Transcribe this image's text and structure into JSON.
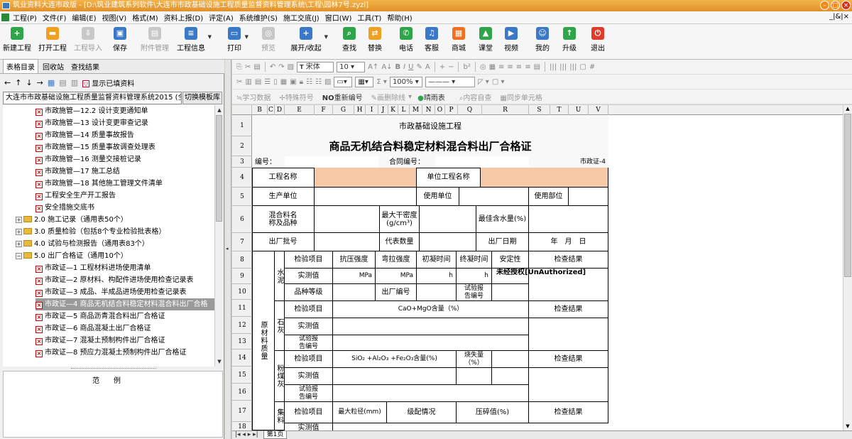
{
  "window": {
    "title": "筑业资料大连市政版 - [D:\\筑业建筑系列软件\\大连市市政基础设施工程质量监督资料管理系统\\工程\\园林7号.zyzl]"
  },
  "menu": {
    "items": [
      "工程(P)",
      "文件(F)",
      "编辑(E)",
      "视图(V)",
      "格式(M)",
      "资料上报(D)",
      "评定(A)",
      "系统维护(S)",
      "施工交底(J)",
      "窗口(W)",
      "工具(T)",
      "帮助(H)"
    ],
    "window_controls": "_|&|×"
  },
  "ribbon": {
    "new_project": "新建工程",
    "open_project": "打开工程",
    "import_project": "工程导入",
    "save": "保存",
    "attachments": "附件管理",
    "project_info": "工程信息",
    "print": "打印",
    "preview": "预览",
    "expand_collapse": "展开/收起",
    "find": "查找",
    "replace": "替换",
    "phone": "电话",
    "service": "客服",
    "mall": "商城",
    "classroom": "课堂",
    "video": "视频",
    "mine": "我的",
    "upgrade": "升级",
    "exit": "退出"
  },
  "left": {
    "tabs": [
      "表格目录",
      "回收站",
      "查找结果"
    ],
    "show_filled": "显示已填资料",
    "system_combo": "大连市市政基础设施工程质量监督资料管理系统2015 (全",
    "switch_template": "切换模板库",
    "tree": [
      "市政施管—12.2 设计变更通知单",
      "市政施管—13 设计变更审查记录",
      "市政施管—14 质量事故报告",
      "市政施管—15 质量事故调查处理表",
      "市政施管—16 测量交接桩记录",
      "市政施管—17 施工总结",
      "市政施管—18 其他施工管理文件清单",
      "工程安全生产开工报告",
      "安全措施交底书",
      "2.0 施工记录（通用表50个）",
      "3.0 质量检验（包括8个专业检验批表格）",
      "4.0 试验与检测报告（通用表83个）",
      "5.0 出厂合格证（通用10个）",
      "市政证—1 工程材料进场使用清单",
      "市政证—2 原材料、构配件进场使用检查记录表",
      "市政证—3 成品、半成品进场使用检查记录表",
      "市政证—4 商品无机结合料稳定材料混合料出厂合格",
      "市政证—5 商品沥青混合料出厂合格证",
      "市政证—6 商品混凝土出厂合格证",
      "市政证—7 混凝土预制构件出厂合格证",
      "市政证—8 预应力混凝土预制构件出厂合格证"
    ],
    "example_label": "范例"
  },
  "editor": {
    "font_name": "宋体",
    "font_size": "10",
    "zoom": "100%",
    "tb3": {
      "learn": "学习数据",
      "special_char": "特殊符号",
      "renumber": "重新编号",
      "draw_slash": "画删除线",
      "weather": "晴雨表",
      "self_check": "内容自查",
      "sync_cell": "同步单元格"
    }
  },
  "sheet": {
    "col_letters": [
      "B",
      "C",
      "D",
      "E",
      "F",
      "G",
      "H",
      "I",
      "J",
      "K",
      "L",
      "M",
      "N",
      "O",
      "P",
      "Q",
      "R",
      "S",
      "T",
      "U",
      "V"
    ],
    "rows": [
      "1",
      "2",
      "3",
      "4",
      "5",
      "6",
      "7",
      "8",
      "9",
      "10",
      "11",
      "12",
      "13",
      "14",
      "15",
      "16",
      "17",
      "18"
    ],
    "header_org": "市政基础设施工程",
    "title": "商品无机结合料稳定材料混合料出厂合格证",
    "number_label": "编号：",
    "contract_label": "合同编号：",
    "form_code": "市政证-4",
    "project_name": "工程名称",
    "unit_project_name": "单位工程名称",
    "producer": "生产单位",
    "user_unit": "使用单位",
    "use_location": "使用部位",
    "mix_name": "混合料名称及品种",
    "max_dry_density": "最大干密度(g/cm³)",
    "optimum_water": "最佳含水量(%)",
    "batch_no": "出厂批号",
    "rep_qty": "代表数量",
    "factory_date": "出厂日期",
    "date_value": "年　月　日",
    "test_item": "检验项目",
    "compressive": "抗压强度",
    "flexural": "弯拉强度",
    "initial_set": "初凝时间",
    "final_set": "终凝时间",
    "stability": "安定性",
    "check_result": "检查结果",
    "measured": "实测值",
    "mpa": "MPa",
    "h": "h",
    "grade": "品种等级",
    "factory_no": "出厂编号",
    "report_no": "试验报告编号",
    "cement": "水泥",
    "lime": "石灰",
    "flyash": "粉煤灰",
    "aggregate": "集料",
    "raw_quality": "原材料质量",
    "cao_mgo": "CaO+MgO含量（%）",
    "sio2": "SiO₂ +Al₂O₃ +Fe₂O₃含量(%)",
    "loss": "烧失量（%）",
    "max_particle": "最大粒径(mm)",
    "gradation": "级配情况",
    "crush": "压碎值(%)",
    "unauth": "未经授权[UnAuthorized]"
  },
  "sheet_tab": "第1页"
}
